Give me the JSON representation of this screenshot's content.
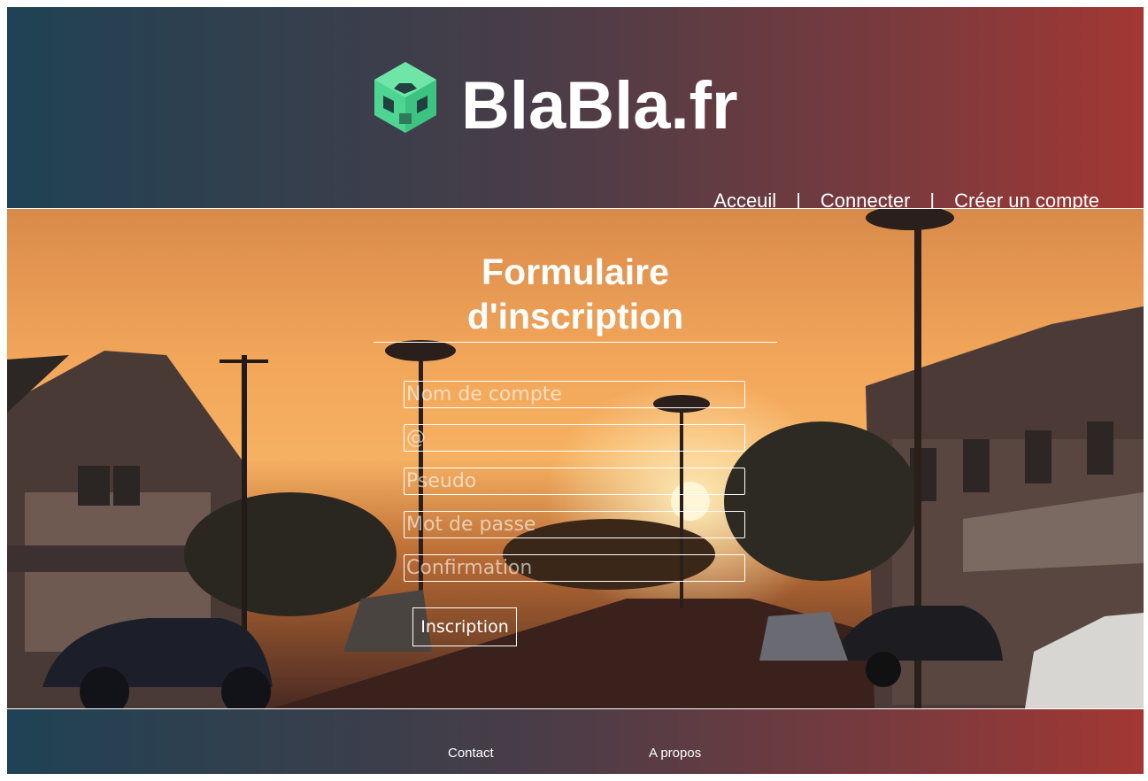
{
  "header": {
    "site_title": "BlaBla.fr",
    "logo_icon": "cube-logo-icon",
    "nav": [
      {
        "label": "Acceuil"
      },
      {
        "label": "Connecter"
      },
      {
        "label": "Créer un compte"
      }
    ],
    "nav_separator": "|"
  },
  "form": {
    "title": "Formulaire d'inscription",
    "fields": [
      {
        "placeholder": "Nom de compte",
        "value": ""
      },
      {
        "placeholder": "@",
        "value": ""
      },
      {
        "placeholder": "Pseudo",
        "value": ""
      },
      {
        "placeholder": "Mot de passe",
        "value": ""
      },
      {
        "placeholder": "Confirmation",
        "value": ""
      }
    ],
    "submit_label": "Inscription"
  },
  "footer": {
    "links": [
      {
        "label": "Contact"
      },
      {
        "label": "A propos"
      }
    ]
  },
  "colors": {
    "header_gradient_start": "#1f4254",
    "header_gradient_end": "#a33733",
    "logo_green": "#4fd592"
  }
}
